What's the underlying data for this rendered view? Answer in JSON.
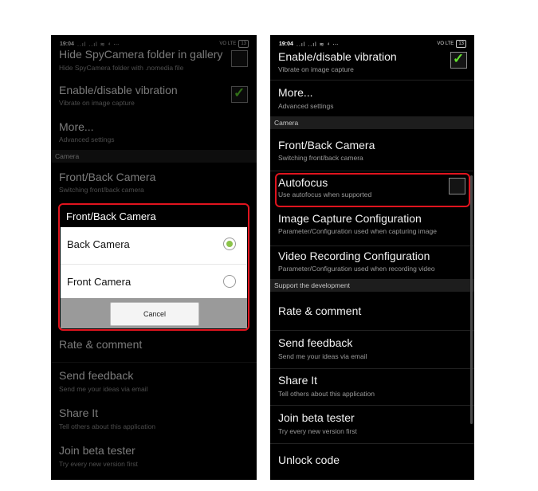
{
  "left_screen": {
    "status_bar": {
      "time": "19:04",
      "indicators": "..ıl ..ıl ≋ ⁴ ⋯",
      "network": "VO LTE",
      "battery": "13"
    },
    "items": [
      {
        "title": "Hide SpyCamera folder in gallery",
        "subtitle": "Hide SpyCamera folder with .nomedia file",
        "checked": false
      },
      {
        "title": "Enable/disable vibration",
        "subtitle": "Vibrate on image capture",
        "checked": true
      },
      {
        "title": "More...",
        "subtitle": "Advanced settings"
      },
      {
        "title": "Front/Back Camera",
        "subtitle": "Switching front/back camera"
      },
      {
        "title": "Rate & comment",
        "subtitle": ""
      },
      {
        "title": "Send feedback",
        "subtitle": "Send me your ideas via email"
      },
      {
        "title": "Share It",
        "subtitle": "Tell others about this application"
      },
      {
        "title": "Join beta tester",
        "subtitle": "Try every new version first"
      }
    ],
    "section_camera": "Camera",
    "dialog": {
      "title": "Front/Back Camera",
      "options": [
        {
          "label": "Back Camera",
          "selected": true
        },
        {
          "label": "Front Camera",
          "selected": false
        }
      ],
      "cancel_label": "Cancel"
    }
  },
  "right_screen": {
    "status_bar": {
      "time": "19:04",
      "indicators": "..ıl ..ıl ≋ ⁴ ⋯",
      "network": "VO LTE",
      "battery": "13"
    },
    "items": [
      {
        "title": "Enable/disable vibration",
        "subtitle": "Vibrate on image capture",
        "checked": true
      },
      {
        "title": "More...",
        "subtitle": "Advanced settings"
      },
      {
        "title": "Front/Back Camera",
        "subtitle": "Switching front/back camera"
      },
      {
        "title": "Autofocus",
        "subtitle": "Use autofocus when supported",
        "checked": false
      },
      {
        "title": "Image Capture Configuration",
        "subtitle": "Parameter/Configuration used when capturing image"
      },
      {
        "title": "Video Recording Configuration",
        "subtitle": "Parameter/Configuration used when recording video"
      },
      {
        "title": "Rate & comment",
        "subtitle": ""
      },
      {
        "title": "Send feedback",
        "subtitle": "Send me your ideas via email"
      },
      {
        "title": "Share It",
        "subtitle": "Tell others about this application"
      },
      {
        "title": "Join beta tester",
        "subtitle": "Try every new version first"
      },
      {
        "title": "Unlock code",
        "subtitle": ""
      }
    ],
    "section_camera": "Camera",
    "section_support": "Support the development"
  },
  "colors": {
    "highlight": "#e0141e",
    "check_green": "#63e12f",
    "radio_green": "#8bc34a"
  }
}
